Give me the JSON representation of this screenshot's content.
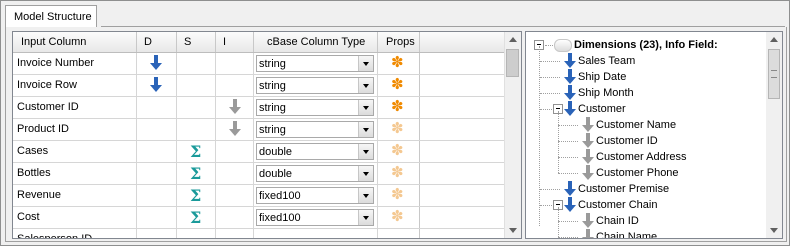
{
  "tab": {
    "label": "Model Structure"
  },
  "grid": {
    "headers": {
      "input_column": "Input Column",
      "d": "D",
      "s": "S",
      "i": "I",
      "type": "cBase Column Type",
      "props": "Props"
    },
    "rows": [
      {
        "name": "Invoice Number",
        "d": true,
        "s": false,
        "i": false,
        "type": "string",
        "props": "active"
      },
      {
        "name": "Invoice Row",
        "d": true,
        "s": false,
        "i": false,
        "type": "string",
        "props": "active"
      },
      {
        "name": "Customer ID",
        "d": false,
        "s": false,
        "i": true,
        "type": "string",
        "props": "active"
      },
      {
        "name": "Product ID",
        "d": false,
        "s": false,
        "i": true,
        "type": "string",
        "props": "inactive"
      },
      {
        "name": "Cases",
        "d": false,
        "s": true,
        "i": false,
        "type": "double",
        "props": "inactive"
      },
      {
        "name": "Bottles",
        "d": false,
        "s": true,
        "i": false,
        "type": "double",
        "props": "inactive"
      },
      {
        "name": "Revenue",
        "d": false,
        "s": true,
        "i": false,
        "type": "fixed100",
        "props": "inactive"
      },
      {
        "name": "Cost",
        "d": false,
        "s": true,
        "i": false,
        "type": "fixed100",
        "props": "inactive"
      }
    ],
    "partial_row": {
      "name": "Salesperson ID"
    }
  },
  "tree": {
    "root": "Dimensions (23), Info Field:",
    "items": [
      {
        "label": "Sales Team",
        "level": 1,
        "kind": "dimension"
      },
      {
        "label": "Ship Date",
        "level": 1,
        "kind": "dimension"
      },
      {
        "label": "Ship Month",
        "level": 1,
        "kind": "dimension"
      },
      {
        "label": "Customer",
        "level": 1,
        "kind": "dimension",
        "expanded": true
      },
      {
        "label": "Customer Name",
        "level": 2,
        "kind": "info"
      },
      {
        "label": "Customer ID",
        "level": 2,
        "kind": "info"
      },
      {
        "label": "Customer Address",
        "level": 2,
        "kind": "info"
      },
      {
        "label": "Customer Phone",
        "level": 2,
        "kind": "info"
      },
      {
        "label": "Customer Premise",
        "level": 1,
        "kind": "dimension"
      },
      {
        "label": "Customer Chain",
        "level": 1,
        "kind": "dimension",
        "expanded": true
      },
      {
        "label": "Chain ID",
        "level": 2,
        "kind": "info"
      },
      {
        "label": "Chain Name",
        "level": 2,
        "kind": "info"
      }
    ]
  },
  "colors": {
    "dimension_arrow": "#2a63b8",
    "info_arrow": "#9a9a9a",
    "sigma": "#1a9a9a",
    "props_active": "#f08a00",
    "props_inactive": "#f4c891"
  }
}
